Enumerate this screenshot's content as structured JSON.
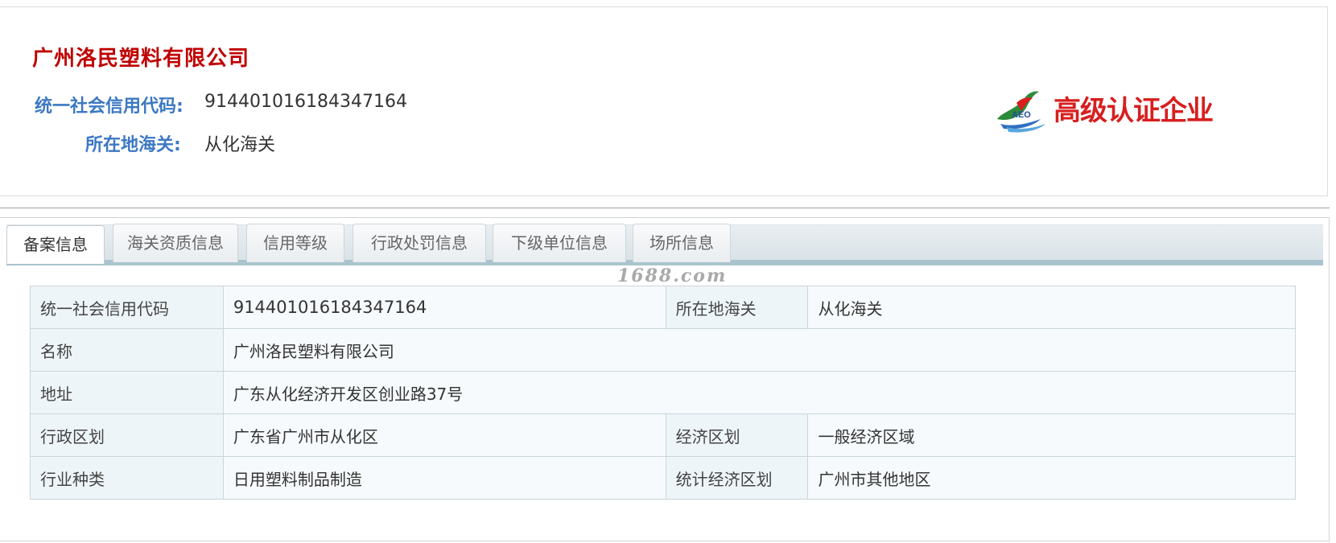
{
  "header": {
    "company_name": "广州洛民塑料有限公司",
    "credit_code_label": "统一社会信用代码:",
    "credit_code_value": "914401016184347164",
    "customs_label": "所在地海关:",
    "customs_value": "从化海关",
    "badge": {
      "small_text": "AEO",
      "title": "高级认证企业",
      "color": "#d81e1e",
      "icon": "aeo-eagle-logo-icon"
    }
  },
  "tabs": [
    {
      "label": "备案信息",
      "active": true
    },
    {
      "label": "海关资质信息",
      "active": false
    },
    {
      "label": "信用等级",
      "active": false
    },
    {
      "label": "行政处罚信息",
      "active": false
    },
    {
      "label": "下级单位信息",
      "active": false
    },
    {
      "label": "场所信息",
      "active": false
    }
  ],
  "watermark": "1688.com",
  "details": {
    "row1": {
      "l1": "统一社会信用代码",
      "v1": "914401016184347164",
      "l2": "所在地海关",
      "v2": "从化海关"
    },
    "row2": {
      "l1": "名称",
      "v1": "广州洛民塑料有限公司"
    },
    "row3": {
      "l1": "地址",
      "v1": "广东从化经济开发区创业路37号"
    },
    "row4": {
      "l1": "行政区划",
      "v1": "广东省广州市从化区",
      "l2": "经济区划",
      "v2": "一般经济区域"
    },
    "row5": {
      "l1": "行业种类",
      "v1": "日用塑料制品制造",
      "l2": "统计经济区划",
      "v2": "广州市其他地区"
    }
  },
  "colors": {
    "company_name": "#c00000",
    "label_blue": "#3c78c3",
    "cell_label_bg": "#eef5f9",
    "cell_value_bg": "#f6fafc"
  }
}
